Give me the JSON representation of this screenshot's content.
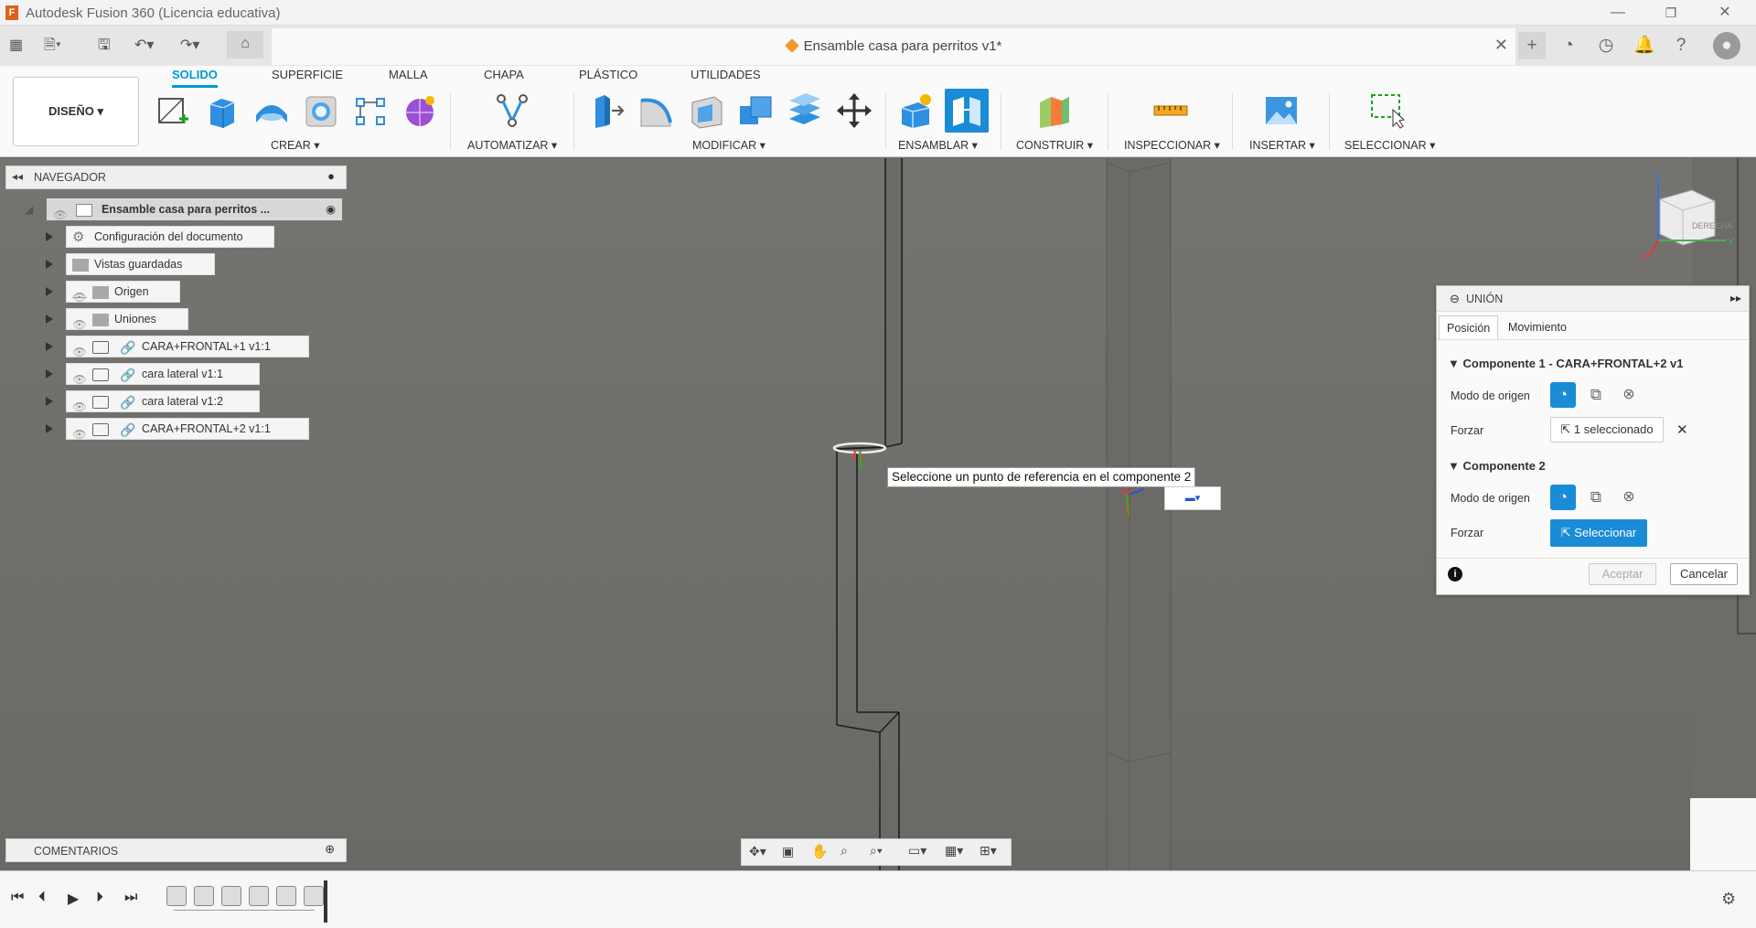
{
  "titlebar": {
    "title": "Autodesk Fusion 360 (Licencia educativa)",
    "icon_letter": "F"
  },
  "document": {
    "tab_title": "Ensamble casa para perritos v1*"
  },
  "workspace": {
    "label": "DISEÑO ▾"
  },
  "ribbon_tabs": [
    "SOLIDO",
    "SUPERFICIE",
    "MALLA",
    "CHAPA",
    "PLÁSTICO",
    "UTILIDADES"
  ],
  "ribbon_groups": {
    "crear": "CREAR ▾",
    "automatizar": "AUTOMATIZAR ▾",
    "modificar": "MODIFICAR ▾",
    "ensamblar": "ENSAMBLAR ▾",
    "construir": "CONSTRUIR ▾",
    "inspeccionar": "INSPECCIONAR ▾",
    "insertar": "INSERTAR ▾",
    "seleccionar": "SELECCIONAR ▾"
  },
  "browser": {
    "title": "NAVEGADOR",
    "root": "Ensamble casa para perritos ...",
    "items": [
      {
        "label": "Configuración del documento"
      },
      {
        "label": "Vistas guardadas"
      },
      {
        "label": "Origen"
      },
      {
        "label": "Uniones"
      },
      {
        "label": "CARA+FRONTAL+1 v1:1"
      },
      {
        "label": "cara lateral v1:1"
      },
      {
        "label": "cara lateral v1:2"
      },
      {
        "label": "CARA+FRONTAL+2 v1:1"
      }
    ]
  },
  "comments": {
    "title": "COMENTARIOS"
  },
  "tooltip": "Seleccione un punto de referencia en el componente 2",
  "viewcube": {
    "face": "DERECHA",
    "z": "Z",
    "y": "Y",
    "x": "X"
  },
  "joint_panel": {
    "title": "UNIÓN",
    "tabs": [
      "Posición",
      "Movimiento"
    ],
    "component1": "Componente 1 - CARA+FRONTAL+2 v1",
    "component2": "Componente 2",
    "origin_mode_label": "Modo de origen",
    "snap_label": "Forzar",
    "selected_text": "1 seleccionado",
    "select_button": "Seleccionar",
    "ok_button": "Aceptar",
    "cancel_button": "Cancelar"
  },
  "colors": {
    "accent": "#0696d7",
    "orange": "#e15f1b"
  }
}
